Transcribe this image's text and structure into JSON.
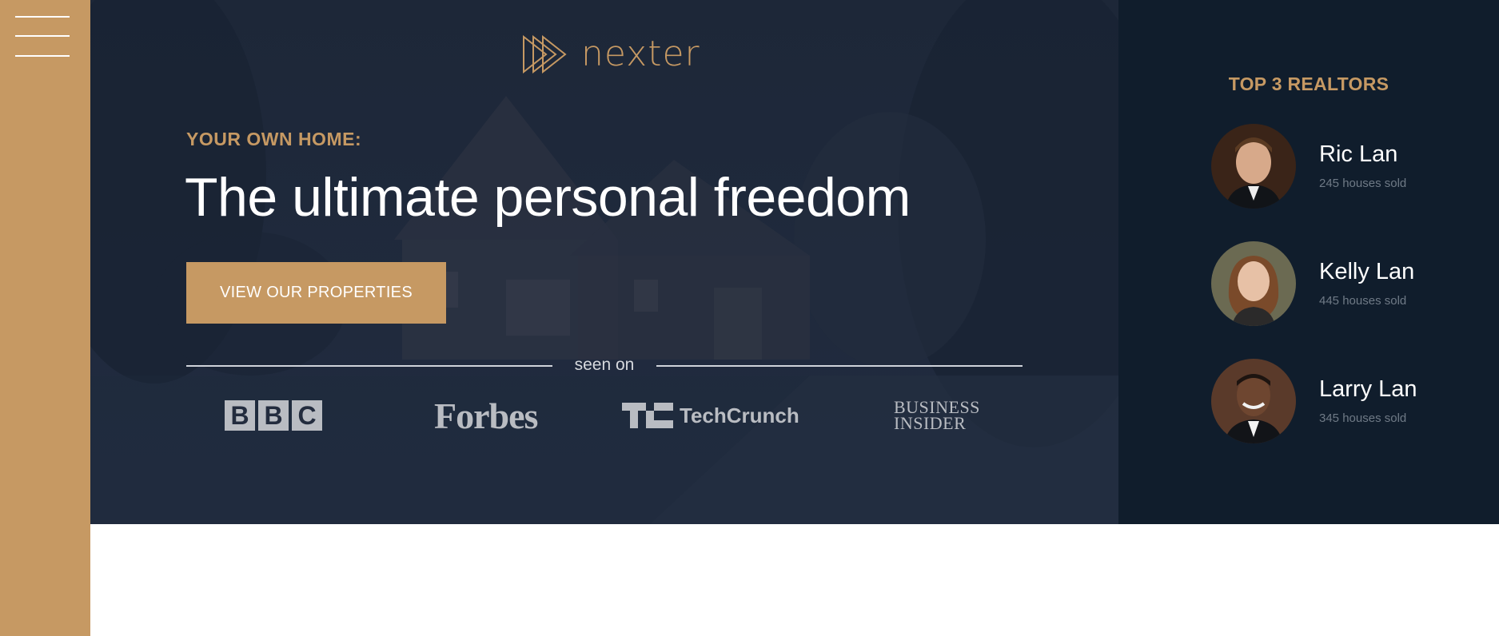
{
  "sidebar": {
    "menu_icon": "hamburger-menu-icon",
    "accent": "#c69963"
  },
  "header": {
    "logo": {
      "icon": "triple-play-triangle-icon",
      "text": "nexter"
    },
    "subtitle": "YOUR OWN HOME:",
    "title": "The ultimate personal freedom",
    "cta_label": "VIEW OUR PROPERTIES",
    "seen_on_label": "seen on",
    "press": {
      "bbc": [
        "B",
        "B",
        "C"
      ],
      "forbes": "Forbes",
      "techcrunch": "TechCrunch",
      "business_insider_line1": "BUSINESS",
      "business_insider_line2": "INSIDER"
    }
  },
  "realtors": {
    "title": "TOP 3 REALTORS",
    "items": [
      {
        "name": "Ric Lan",
        "sold": "245 houses sold"
      },
      {
        "name": "Kelly Lan",
        "sold": "445 houses sold"
      },
      {
        "name": "Larry Lan",
        "sold": "345 houses sold"
      }
    ]
  },
  "colors": {
    "primary": "#c69963",
    "dark": "#101d2c",
    "hero_overlay": "#1d2738"
  }
}
